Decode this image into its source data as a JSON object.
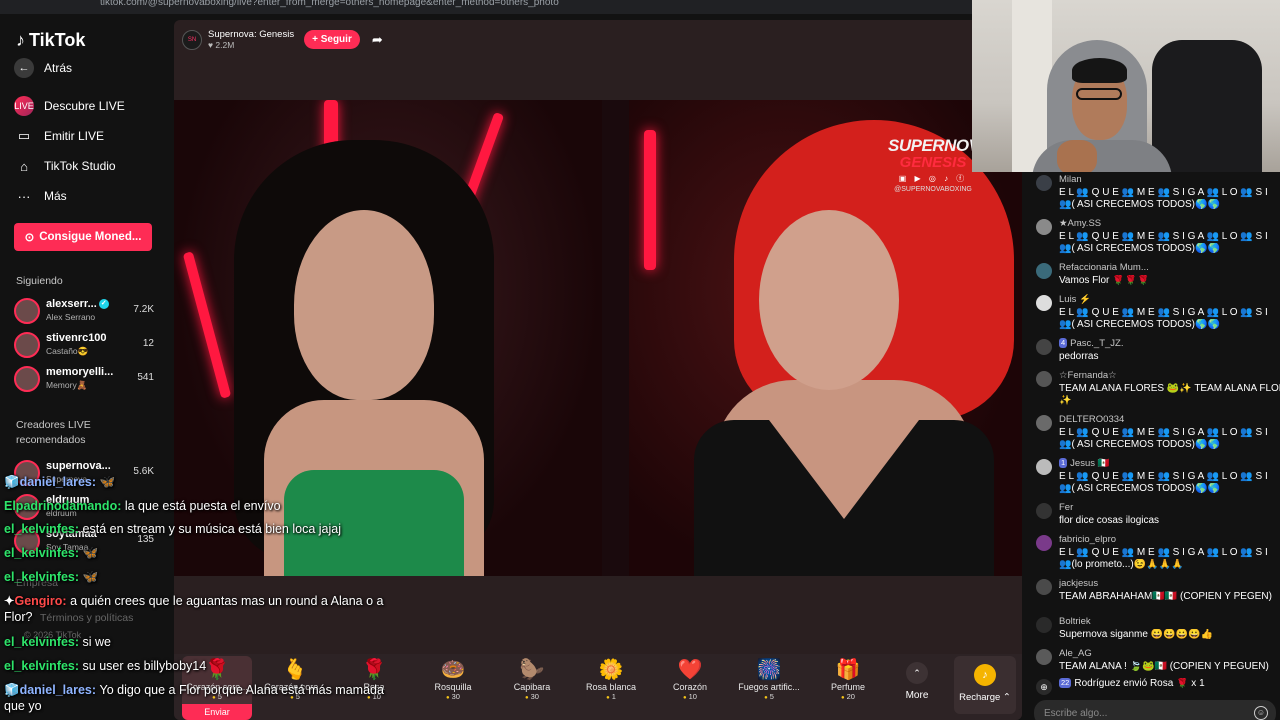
{
  "browser": {
    "url": "tiktok.com/@supernovaboxing/live?enter_from_merge=others_homepage&enter_method=others_photo"
  },
  "sidebar": {
    "logo": "TikTok",
    "nav": [
      {
        "label": "Atrás",
        "icon": "back-arrow-icon",
        "glyph": "←"
      },
      {
        "label": "Descubre LIVE",
        "icon": "live-discover-icon",
        "glyph": "LIVE"
      },
      {
        "label": "Emitir LIVE",
        "icon": "camera-icon",
        "glyph": "▭"
      },
      {
        "label": "TikTok Studio",
        "icon": "studio-icon",
        "glyph": "⌂"
      },
      {
        "label": "Más",
        "icon": "more-dots-icon",
        "glyph": "···"
      }
    ],
    "coins_button": "Consigue Moned...",
    "following_title": "Siguiendo",
    "following": [
      {
        "name": "alexserr...",
        "sub": "Alex Serrano",
        "count": "7.2K",
        "verified": true
      },
      {
        "name": "stivenrc100",
        "sub": "Castaño😎",
        "count": "12",
        "verified": false
      },
      {
        "name": "memoryelli...",
        "sub": "Memory🧸",
        "count": "541",
        "verified": false
      }
    ],
    "recommended_title": "Creadores LIVE recomendados",
    "recommended": [
      {
        "name": "supernova...",
        "sub": "Supernova",
        "count": "5.6K"
      },
      {
        "name": "eldruum",
        "sub": "eldruum",
        "count": ""
      },
      {
        "name": "soytamaa",
        "sub": "Soy Tamaa",
        "count": "135"
      }
    ],
    "footer_company": "Empresa",
    "footer_terms": "Términos y políticas",
    "footer_copy": "© 2026 TikTok"
  },
  "stream": {
    "host_name": "Supernova: Genesis",
    "likes": "2.2M",
    "follow_label": "+ Seguir",
    "brand_line1": "SUPERNOVA",
    "brand_line2": "GENESIS",
    "brand_handle": "@SUPERNOVABOXING",
    "brand_icons": "▣ ▶ ◎ ♪ ⓕ"
  },
  "gifts": [
    {
      "name": "Corazón core...",
      "price": "5",
      "glyph": "🌹",
      "send": "Enviar"
    },
    {
      "name": "Corazón core...",
      "price": "5",
      "glyph": "🫰"
    },
    {
      "name": "Rosa",
      "price": "10",
      "glyph": "🌹"
    },
    {
      "name": "Rosquilla",
      "price": "30",
      "glyph": "🍩"
    },
    {
      "name": "Capibara",
      "price": "30",
      "glyph": "🦫"
    },
    {
      "name": "Rosa blanca",
      "price": "1",
      "glyph": "🌼"
    },
    {
      "name": "Corazón",
      "price": "10",
      "glyph": "❤️"
    },
    {
      "name": "Fuegos artific...",
      "price": "5",
      "glyph": "🎆"
    },
    {
      "name": "Perfume",
      "price": "20",
      "glyph": "🎁"
    }
  ],
  "more_label": "More",
  "recharge_label": "Recharge ⌃",
  "overlay_chat": [
    {
      "user": "daniel_lares:",
      "text": "🦋",
      "color": "blue",
      "prefix": "🧊"
    },
    {
      "user": "Elpadrinodamando:",
      "text": "la que está puesta el envívo",
      "color": "green",
      "prefix": ""
    },
    {
      "user": "el_kelvinfes:",
      "text": "está en stream y su música está bien loca jajaj",
      "color": "green",
      "prefix": ""
    },
    {
      "user": "el_kelvinfes:",
      "text": "🦋",
      "color": "green",
      "prefix": ""
    },
    {
      "user": "el_kelvinfes:",
      "text": "🦋",
      "color": "green",
      "prefix": ""
    },
    {
      "user": "Gengiro:",
      "text": "a quién crees que le aguantas mas un round a Alana o a Flor?",
      "color": "red",
      "prefix": "✦"
    },
    {
      "user": "el_kelvinfes:",
      "text": "si we",
      "color": "green",
      "prefix": ""
    },
    {
      "user": "el_kelvinfes:",
      "text": "su user es billyboby14",
      "color": "green",
      "prefix": ""
    },
    {
      "user": "daniel_lares:",
      "text": "Yo digo que a Flor porque Alana está más mamada que yo",
      "color": "blue",
      "prefix": "🧊"
    }
  ],
  "chat": [
    {
      "name": "Milan",
      "text": "E L 👥 Q U E 👥 M E 👥 S I G A 👥 L O 👥 S I",
      "text2": "👥( ASI CRECEMOS TODOS)🌎🌎",
      "lvl": ""
    },
    {
      "name": "★Amy.SS",
      "text": "E L 👥 Q U E 👥 M E 👥 S I G A 👥 L O 👥 S I",
      "text2": "👥( ASI CRECEMOS TODOS)🌎🌎",
      "lvl": ""
    },
    {
      "name": "Refaccionaria Mum...",
      "text": "Vamos Flor 🌹🌹🌹",
      "text2": "",
      "lvl": ""
    },
    {
      "name": "Luis ⚡",
      "text": "E L 👥 Q U E 👥 M E 👥 S I G A 👥 L O 👥 S I",
      "text2": "👥( ASI CRECEMOS TODOS)🌎🌎",
      "lvl": ""
    },
    {
      "name": "Pasc._T_JZ.",
      "text": "pedorras",
      "text2": "",
      "lvl": "4"
    },
    {
      "name": "☆Fernanda☆",
      "text": "TEAM ALANA FLORES 🐸✨ TEAM ALANA FLORES",
      "text2": "✨",
      "lvl": ""
    },
    {
      "name": "DELTERO0334",
      "text": "E L 👥 Q U E 👥 M E 👥 S I G A 👥 L O 👥 S I",
      "text2": "👥( ASI CRECEMOS TODOS)🌎🌎",
      "lvl": ""
    },
    {
      "name": "Jesus 🇲🇽",
      "text": "E L 👥 Q U E 👥 M E 👥 S I G A 👥 L O 👥 S I",
      "text2": "👥( ASI CRECEMOS TODOS)🌎🌎",
      "lvl": "1"
    },
    {
      "name": "Fer",
      "text": "flor dice cosas ilogicas",
      "text2": "",
      "lvl": ""
    },
    {
      "name": "fabricio_elpro",
      "text": "E L 👥 Q U E 👥 M E 👥 S I G A 👥 L O 👥 S I",
      "text2": "👥(lo prometo...)😉🙏🙏🙏",
      "lvl": ""
    },
    {
      "name": "jackjesus",
      "text": "TEAM ABRAHAHAM🇲🇽🇲🇽 (COPIEN Y PEGEN)",
      "text2": "",
      "lvl": ""
    },
    {
      "name": "Boltriek",
      "text": "Supernova siganme 😀😀😀😀👍",
      "text2": "",
      "lvl": ""
    },
    {
      "name": "Ale_AG",
      "text": "TEAM ALANA ! 🍃🐸🇲🇽 (COPIEN Y PEGUEN)",
      "text2": "",
      "lvl": ""
    }
  ],
  "gift_notice": {
    "lvl": "22",
    "text": "Rodríguez envió Rosa 🌹 x 1"
  },
  "chat_input_placeholder": "Escribe algo..."
}
